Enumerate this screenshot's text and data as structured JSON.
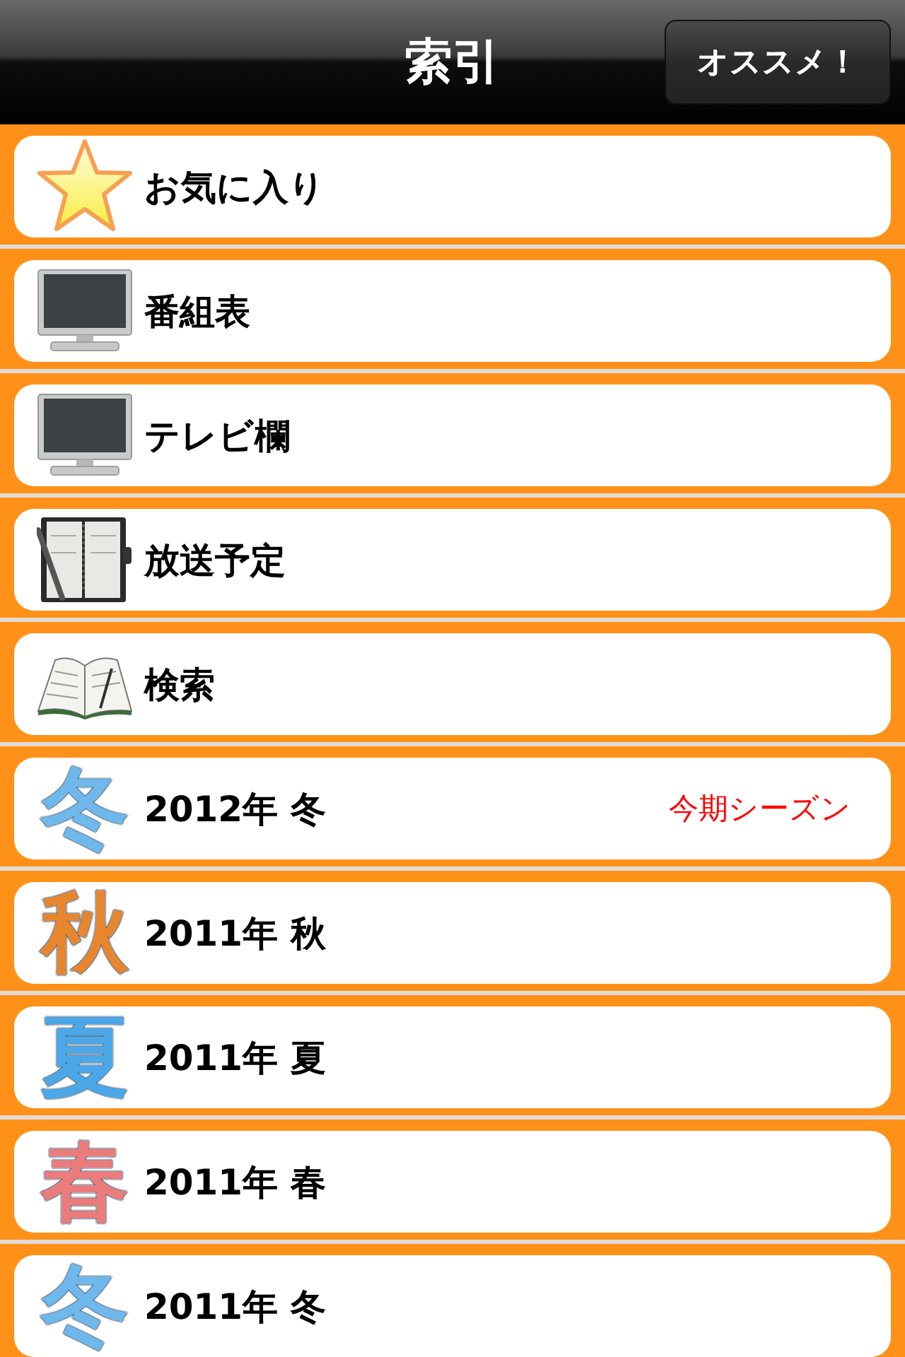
{
  "header": {
    "title": "索引",
    "button": "オススメ！"
  },
  "items": [
    {
      "kind": "star",
      "label": "お気に入り"
    },
    {
      "kind": "tv",
      "label": "番組表"
    },
    {
      "kind": "tv",
      "label": "テレビ欄"
    },
    {
      "kind": "planner",
      "label": "放送予定"
    },
    {
      "kind": "book",
      "label": "検索"
    },
    {
      "kind": "season",
      "glyph": "冬",
      "color": "#6fb8ec",
      "label": "2012年 冬",
      "badge": "今期シーズン"
    },
    {
      "kind": "season",
      "glyph": "秋",
      "color": "#e8862e",
      "label": "2011年 秋"
    },
    {
      "kind": "season",
      "glyph": "夏",
      "color": "#4aa8e8",
      "label": "2011年 夏"
    },
    {
      "kind": "season",
      "glyph": "春",
      "color": "#ec7c7c",
      "label": "2011年 春"
    },
    {
      "kind": "season",
      "glyph": "冬",
      "color": "#6fb8ec",
      "label": "2011年 冬"
    }
  ]
}
